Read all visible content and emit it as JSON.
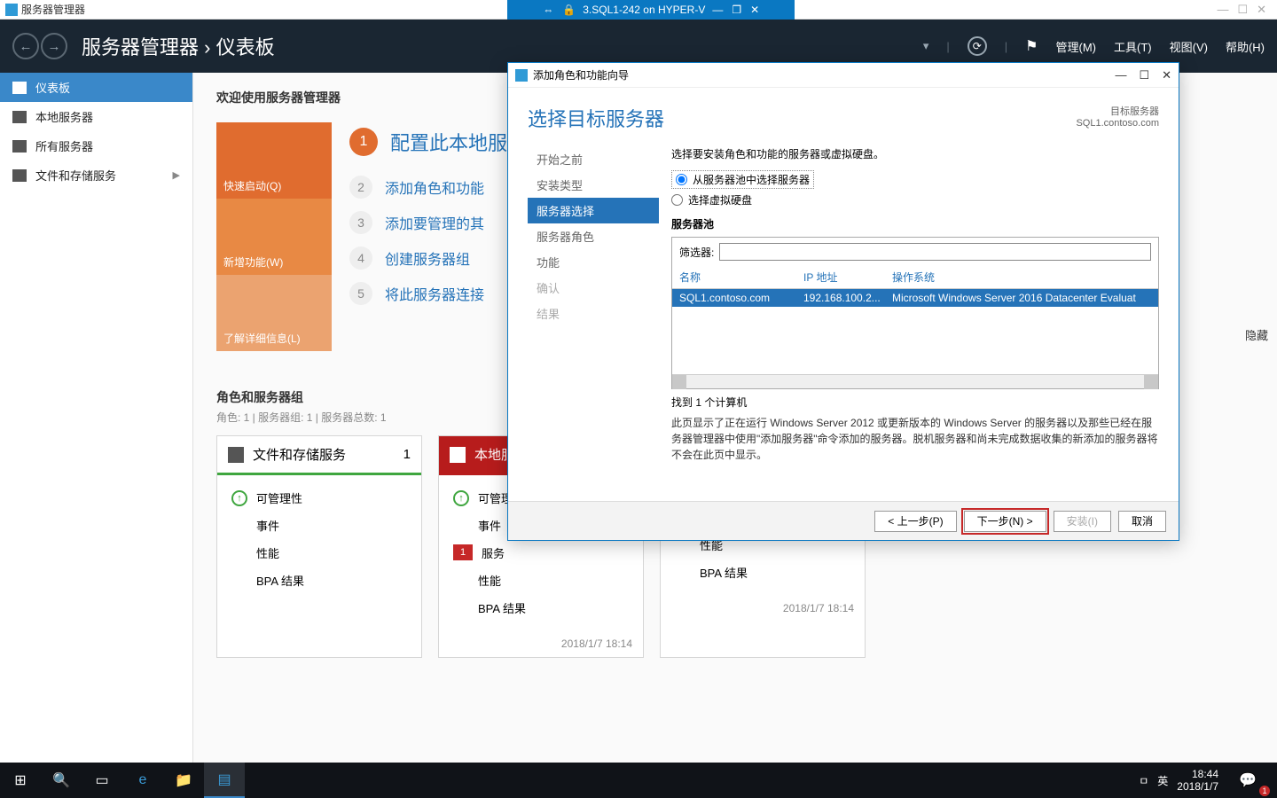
{
  "vm": {
    "app_title": "服务器管理器",
    "session_title": "3.SQL1-242 on HYPER-V",
    "win_min": "—",
    "win_max": "☐",
    "win_close": "✕",
    "pin": "⇔",
    "lock": "🔒"
  },
  "header": {
    "breadcrumb_main": "服务器管理器",
    "breadcrumb_sep": "›",
    "breadcrumb_sub": "仪表板",
    "menu_manage": "管理(M)",
    "menu_tools": "工具(T)",
    "menu_view": "视图(V)",
    "menu_help": "帮助(H)"
  },
  "sidebar": {
    "dashboard": "仪表板",
    "local": "本地服务器",
    "all": "所有服务器",
    "file": "文件和存储服务"
  },
  "welcome": {
    "title": "欢迎使用服务器管理器",
    "tile1": "快速启动(Q)",
    "tile2": "新增功能(W)",
    "tile3": "了解详细信息(L)",
    "step1": "配置此本地服",
    "step2": "添加角色和功能",
    "step3": "添加要管理的其",
    "step4": "创建服务器组",
    "step5": "将此服务器连接"
  },
  "roles": {
    "title": "角色和服务器组",
    "subtitle": "角色: 1 | 服务器组: 1 | 服务器总数: 1"
  },
  "cards": {
    "file": {
      "title": "文件和存储服务",
      "count": "1",
      "manage": "可管理性",
      "events": "事件",
      "perf": "性能",
      "bpa": "BPA 结果"
    },
    "local": {
      "title": "本地服",
      "manage": "可管理性",
      "events": "事件",
      "services": "服务",
      "perf": "性能",
      "bpa": "BPA 结果",
      "badge": "1",
      "timestamp": "2018/1/7 18:14"
    },
    "third": {
      "perf": "性能",
      "bpa": "BPA 结果",
      "timestamp": "2018/1/7 18:14"
    }
  },
  "hide": "隐藏",
  "wizard": {
    "title": "添加角色和功能向导",
    "header": "选择目标服务器",
    "target_label": "目标服务器",
    "target_server": "SQL1.contoso.com",
    "nav": {
      "before": "开始之前",
      "type": "安装类型",
      "select": "服务器选择",
      "roles": "服务器角色",
      "features": "功能",
      "confirm": "确认",
      "result": "结果"
    },
    "desc": "选择要安装角色和功能的服务器或虚拟硬盘。",
    "radio1": "从服务器池中选择服务器",
    "radio2": "选择虚拟硬盘",
    "pool_label": "服务器池",
    "filter_label": "筛选器:",
    "th_name": "名称",
    "th_ip": "IP 地址",
    "th_os": "操作系统",
    "row_name": "SQL1.contoso.com",
    "row_ip": "192.168.100.2...",
    "row_os": "Microsoft Windows Server 2016 Datacenter Evaluat",
    "found": "找到 1 个计算机",
    "note": "此页显示了正在运行 Windows Server 2012 或更新版本的 Windows Server 的服务器以及那些已经在服务器管理器中使用\"添加服务器\"命令添加的服务器。脱机服务器和尚未完成数据收集的新添加的服务器将不会在此页中显示。",
    "btn_prev": "< 上一步(P)",
    "btn_next": "下一步(N) >",
    "btn_install": "安装(I)",
    "btn_cancel": "取消"
  },
  "taskbar": {
    "ime1": "ㅁ",
    "ime2": "英",
    "time": "18:44",
    "date": "2018/1/7",
    "notif_count": "1"
  }
}
